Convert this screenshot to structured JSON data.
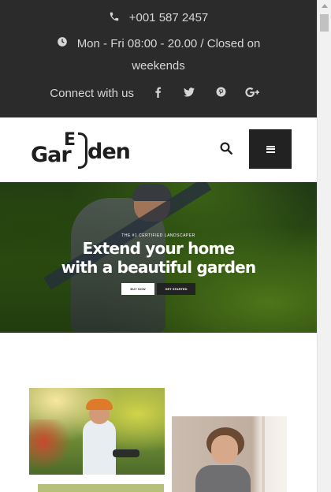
{
  "topbar": {
    "phone": "+001 587 2457",
    "hours": "Mon - Fri 08:00 - 20.00 / Closed on weekends",
    "connect_label": "Connect with us",
    "social": [
      {
        "name": "facebook",
        "glyph": "f"
      },
      {
        "name": "twitter",
        "glyph": "t"
      },
      {
        "name": "pinterest",
        "glyph": "p"
      },
      {
        "name": "google-plus",
        "glyph": "G+"
      }
    ]
  },
  "header": {
    "logo": {
      "part1": "Gar",
      "letter": "E",
      "part2": "den"
    }
  },
  "hero": {
    "kicker": "THE #1 CERTIFIED LANDSCAPER",
    "title_line1": "Extend your home",
    "title_line2": "with a beautiful garden",
    "primary_button": "BUY NOW",
    "secondary_button": "GET STARTED"
  },
  "colors": {
    "topbar_bg": "#2b2b2b",
    "topbar_text": "#d6d6d6",
    "menu_button_bg": "#222222",
    "hero_green": "#355f17"
  },
  "icons": [
    "phone-icon",
    "clock-icon",
    "facebook-icon",
    "twitter-icon",
    "pinterest-icon",
    "google-plus-icon",
    "search-icon",
    "menu-icon"
  ]
}
